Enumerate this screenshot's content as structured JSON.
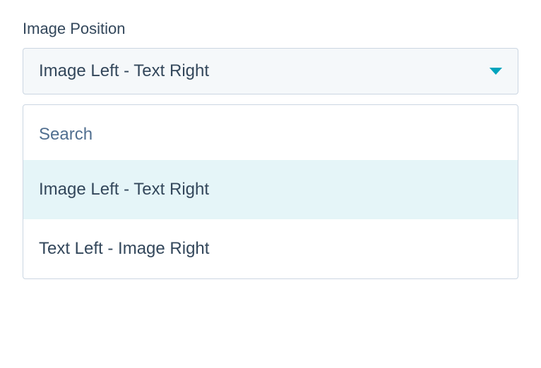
{
  "field": {
    "label": "Image Position",
    "selected_value": "Image Left - Text Right"
  },
  "search": {
    "placeholder": "Search",
    "value": ""
  },
  "options": [
    {
      "label": "Image Left - Text Right",
      "selected": true
    },
    {
      "label": "Text Left - Image Right",
      "selected": false
    }
  ],
  "colors": {
    "accent": "#00a4bd",
    "text": "#33475b",
    "border": "#cbd6e2",
    "highlight_bg": "#e5f5f8",
    "select_bg": "#f5f8fa"
  }
}
